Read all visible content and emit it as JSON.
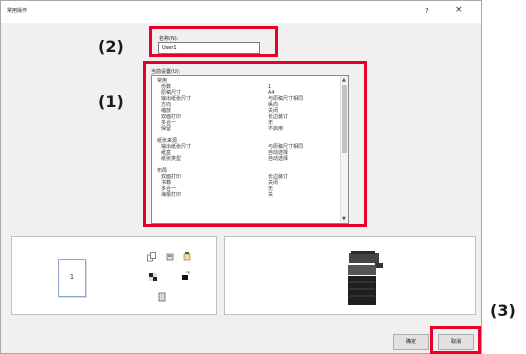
{
  "dialog": {
    "title": "常用操作",
    "help_label": "?",
    "close_label": "×"
  },
  "markers": {
    "m1": "(1)",
    "m2": "(2)",
    "m3": "(3)"
  },
  "name_field": {
    "label": "名称(N):",
    "value": "User1"
  },
  "settings": {
    "label": "当前设置(U):",
    "rows": [
      {
        "k": "常用",
        "v": "",
        "type": "header"
      },
      {
        "k": "份数",
        "v": "1",
        "type": "item"
      },
      {
        "k": "原稿尺寸",
        "v": "A4",
        "type": "item"
      },
      {
        "k": "输出纸张尺寸",
        "v": "与原稿尺寸相同",
        "type": "item"
      },
      {
        "k": "方向",
        "v": "纵向",
        "type": "item"
      },
      {
        "k": "缩放",
        "v": "关闭",
        "type": "item"
      },
      {
        "k": "双面打印",
        "v": "长边装订",
        "type": "item"
      },
      {
        "k": "多合一",
        "v": "无",
        "type": "item"
      },
      {
        "k": "保留",
        "v": "不启用",
        "type": "item"
      },
      {
        "k": "",
        "v": "",
        "type": "blank"
      },
      {
        "k": "纸张来源",
        "v": "",
        "type": "header"
      },
      {
        "k": "输出纸张尺寸",
        "v": "与原稿尺寸相同",
        "type": "item"
      },
      {
        "k": "纸盒",
        "v": "自动选择",
        "type": "item"
      },
      {
        "k": "纸张类型",
        "v": "自动选择",
        "type": "item"
      },
      {
        "k": "",
        "v": "",
        "type": "blank"
      },
      {
        "k": "布局",
        "v": "",
        "type": "header"
      },
      {
        "k": "双面打印",
        "v": "长边装订",
        "type": "item"
      },
      {
        "k": "书籍",
        "v": "关闭",
        "type": "item"
      },
      {
        "k": "多合一",
        "v": "无",
        "type": "item"
      },
      {
        "k": "海报打印",
        "v": "关",
        "type": "item"
      }
    ]
  },
  "preview": {
    "page_number": "1"
  },
  "buttons": {
    "ok": "确定",
    "cancel": "取消"
  },
  "colors": {
    "highlight": "#e8002a",
    "dialog_bg": "#f0f0f0"
  },
  "icons": [
    "copy-icon",
    "staple-icon",
    "punch-icon",
    "color-mode-icon",
    "toner-icon",
    "document-icon",
    "printer-icon"
  ]
}
